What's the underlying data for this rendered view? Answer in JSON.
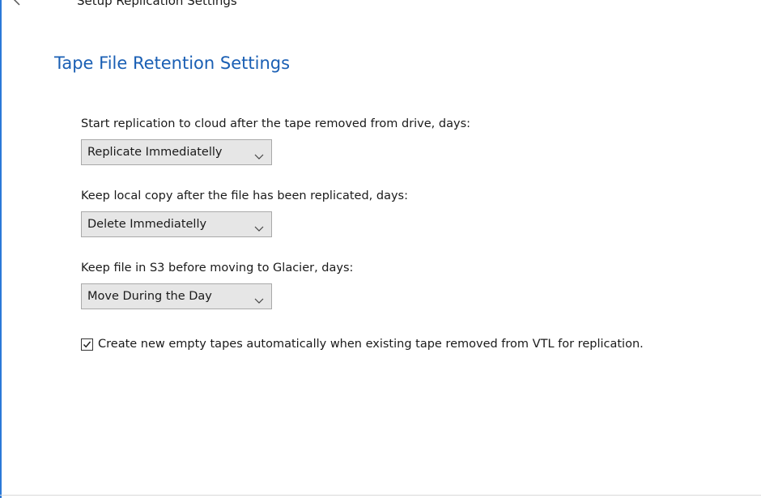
{
  "window": {
    "title": "Setup Replication Settings",
    "back_icon": "back-arrow-icon"
  },
  "page": {
    "title": "Tape File Retention Settings"
  },
  "fields": [
    {
      "label": "Start replication to cloud after the tape removed from drive, days:",
      "value": "Replicate Immediatelly"
    },
    {
      "label": "Keep local copy after the file has been replicated, days:",
      "value": "Delete Immediatelly"
    },
    {
      "label": "Keep file in S3 before moving to Glacier, days:",
      "value": "Move During the Day"
    }
  ],
  "option": {
    "checked": true,
    "label": "Create new empty tapes automatically when existing tape removed from VTL for replication."
  },
  "colors": {
    "accent": "#1a5fb4",
    "window_border": "#2b79d8",
    "combo_background": "#e6e6e6"
  }
}
